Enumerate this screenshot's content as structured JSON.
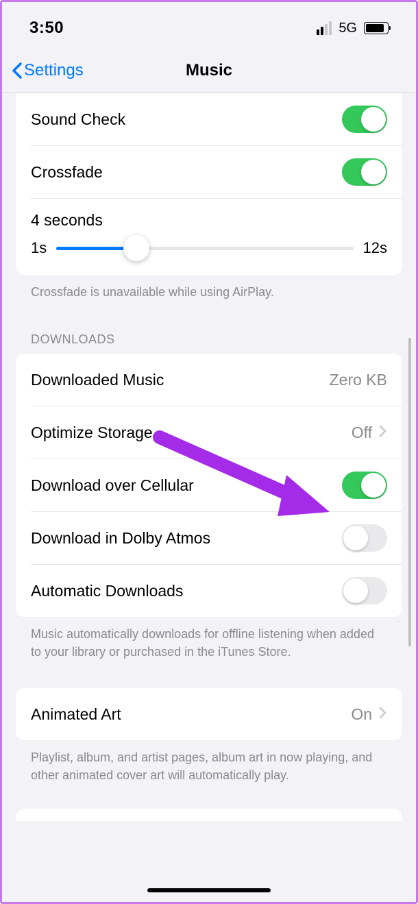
{
  "status": {
    "time": "3:50",
    "network": "5G"
  },
  "nav": {
    "back_label": "Settings",
    "title": "Music"
  },
  "playback_group": {
    "sound_check": {
      "label": "Sound Check",
      "on": true
    },
    "crossfade": {
      "label": "Crossfade",
      "on": true
    },
    "slider": {
      "value_label": "4 seconds",
      "min_label": "1s",
      "max_label": "12s"
    }
  },
  "playback_footer": "Crossfade is unavailable while using AirPlay.",
  "downloads_header": "DOWNLOADS",
  "downloads_group": {
    "downloaded_music": {
      "label": "Downloaded Music",
      "value": "Zero KB"
    },
    "optimize_storage": {
      "label": "Optimize Storage",
      "value": "Off"
    },
    "download_cellular": {
      "label": "Download over Cellular",
      "on": true
    },
    "download_dolby": {
      "label": "Download in Dolby Atmos",
      "on": false
    },
    "auto_downloads": {
      "label": "Automatic Downloads",
      "on": false
    }
  },
  "downloads_footer": "Music automatically downloads for offline listening when added to your library or purchased in the iTunes Store.",
  "art_group": {
    "animated_art": {
      "label": "Animated Art",
      "value": "On"
    }
  },
  "art_footer": "Playlist, album, and artist pages, album art in now playing, and other animated cover art will automatically play.",
  "annotation": {
    "color": "#a42be8"
  }
}
